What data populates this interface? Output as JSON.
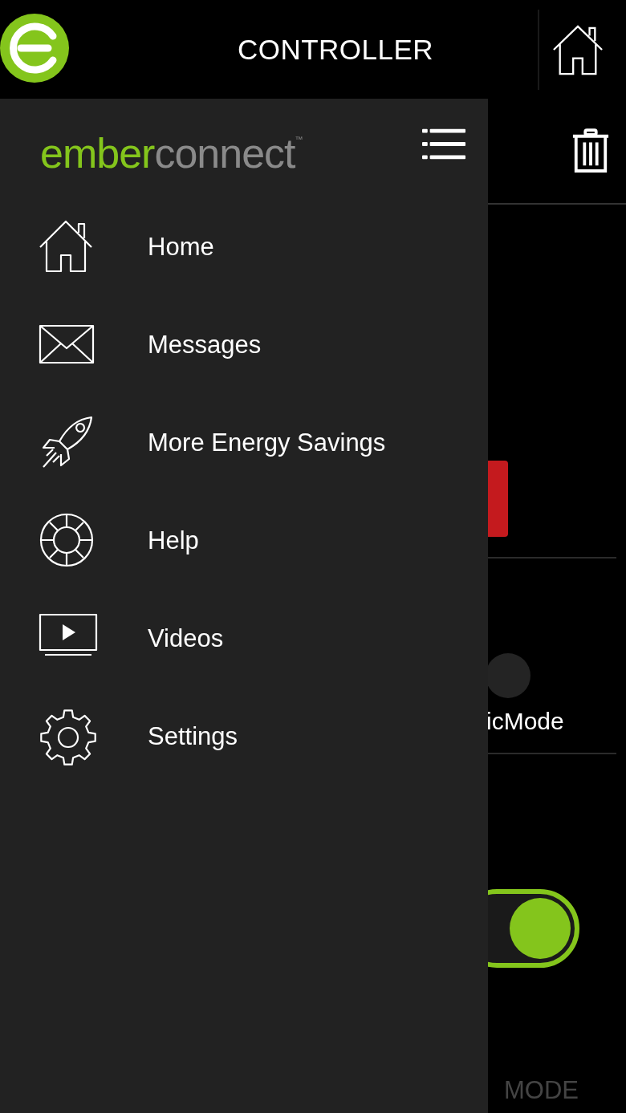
{
  "header": {
    "title": "CONTROLLER"
  },
  "drawer": {
    "brand": {
      "first": "ember",
      "second": "connect",
      "trademark": "™"
    },
    "items": [
      {
        "label": "Home"
      },
      {
        "label": "Messages"
      },
      {
        "label": "More Energy Savings"
      },
      {
        "label": "Help"
      },
      {
        "label": "Videos"
      },
      {
        "label": "Settings"
      }
    ]
  },
  "background": {
    "mode_radio": {
      "selected": false
    },
    "mode_label": "icMode",
    "toggle": {
      "on": true
    },
    "bottom_label": "MODE"
  }
}
